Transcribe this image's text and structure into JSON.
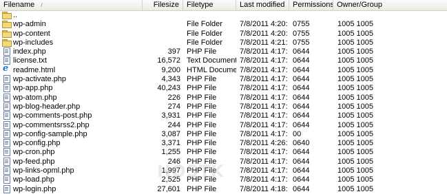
{
  "columns": {
    "filename": "Filename",
    "filesize": "Filesize",
    "filetype": "Filetype",
    "last_modified": "Last modified",
    "permissions": "Permissions",
    "owner_group": "Owner/Group"
  },
  "sort_indicator": "/",
  "rows": [
    {
      "icon": "up-folder-icon",
      "name": "..",
      "size": "",
      "type": "",
      "modified": "",
      "perms": "",
      "owner": ""
    },
    {
      "icon": "folder-icon",
      "name": "wp-admin",
      "size": "",
      "type": "File Folder",
      "modified": "7/8/2011 4:20:...",
      "perms": "0755",
      "owner": "1005 1005"
    },
    {
      "icon": "folder-icon",
      "name": "wp-content",
      "size": "",
      "type": "File Folder",
      "modified": "7/8/2011 4:20:...",
      "perms": "0755",
      "owner": "1005 1005"
    },
    {
      "icon": "folder-icon",
      "name": "wp-includes",
      "size": "",
      "type": "File Folder",
      "modified": "7/8/2011 4:21:...",
      "perms": "0755",
      "owner": "1005 1005"
    },
    {
      "icon": "php-file-icon",
      "name": "index.php",
      "size": "397",
      "type": "PHP File",
      "modified": "7/8/2011 4:17:...",
      "perms": "0644",
      "owner": "1005 1005"
    },
    {
      "icon": "text-file-icon",
      "name": "license.txt",
      "size": "16,572",
      "type": "Text Document",
      "modified": "7/8/2011 4:17:...",
      "perms": "0644",
      "owner": "1005 1005"
    },
    {
      "icon": "html-file-icon",
      "name": "readme.html",
      "size": "9,200",
      "type": "HTML Document",
      "modified": "7/8/2011 4:17:...",
      "perms": "0644",
      "owner": "1005 1005"
    },
    {
      "icon": "php-file-icon",
      "name": "wp-activate.php",
      "size": "4,343",
      "type": "PHP File",
      "modified": "7/8/2011 4:17:...",
      "perms": "0644",
      "owner": "1005 1005"
    },
    {
      "icon": "php-file-icon",
      "name": "wp-app.php",
      "size": "40,243",
      "type": "PHP File",
      "modified": "7/8/2011 4:17:...",
      "perms": "0644",
      "owner": "1005 1005"
    },
    {
      "icon": "php-file-icon",
      "name": "wp-atom.php",
      "size": "226",
      "type": "PHP File",
      "modified": "7/8/2011 4:17:...",
      "perms": "0644",
      "owner": "1005 1005"
    },
    {
      "icon": "php-file-icon",
      "name": "wp-blog-header.php",
      "size": "274",
      "type": "PHP File",
      "modified": "7/8/2011 4:17:...",
      "perms": "0644",
      "owner": "1005 1005"
    },
    {
      "icon": "php-file-icon",
      "name": "wp-comments-post.php",
      "size": "3,931",
      "type": "PHP File",
      "modified": "7/8/2011 4:17:...",
      "perms": "0644",
      "owner": "1005 1005"
    },
    {
      "icon": "php-file-icon",
      "name": "wp-commentsrss2.php",
      "size": "244",
      "type": "PHP File",
      "modified": "7/8/2011 4:17:...",
      "perms": "0644",
      "owner": "1005 1005"
    },
    {
      "icon": "php-file-icon",
      "name": "wp-config-sample.php",
      "size": "3,087",
      "type": "PHP File",
      "modified": "7/8/2011 4:17:...",
      "perms": "00",
      "owner": "1005 1005"
    },
    {
      "icon": "php-file-icon",
      "name": "wp-config.php",
      "size": "3,371",
      "type": "PHP File",
      "modified": "7/8/2011 4:26:...",
      "perms": "0640",
      "owner": "1005 1005"
    },
    {
      "icon": "php-file-icon",
      "name": "wp-cron.php",
      "size": "1,255",
      "type": "PHP File",
      "modified": "7/8/2011 4:17:...",
      "perms": "0644",
      "owner": "1005 1005"
    },
    {
      "icon": "php-file-icon",
      "name": "wp-feed.php",
      "size": "246",
      "type": "PHP File",
      "modified": "7/8/2011 4:17:...",
      "perms": "0644",
      "owner": "1005 1005"
    },
    {
      "icon": "php-file-icon",
      "name": "wp-links-opml.php",
      "size": "1,997",
      "type": "PHP File",
      "modified": "7/8/2011 4:17:...",
      "perms": "0644",
      "owner": "1005 1005"
    },
    {
      "icon": "php-file-icon",
      "name": "wp-load.php",
      "size": "2,525",
      "type": "PHP File",
      "modified": "7/8/2011 4:17:...",
      "perms": "0644",
      "owner": "1005 1005"
    },
    {
      "icon": "php-file-icon",
      "name": "wp-login.php",
      "size": "27,601",
      "type": "PHP File",
      "modified": "7/8/2011 4:18:...",
      "perms": "0644",
      "owner": "1005 1005"
    }
  ],
  "watermark": "HOSTK"
}
